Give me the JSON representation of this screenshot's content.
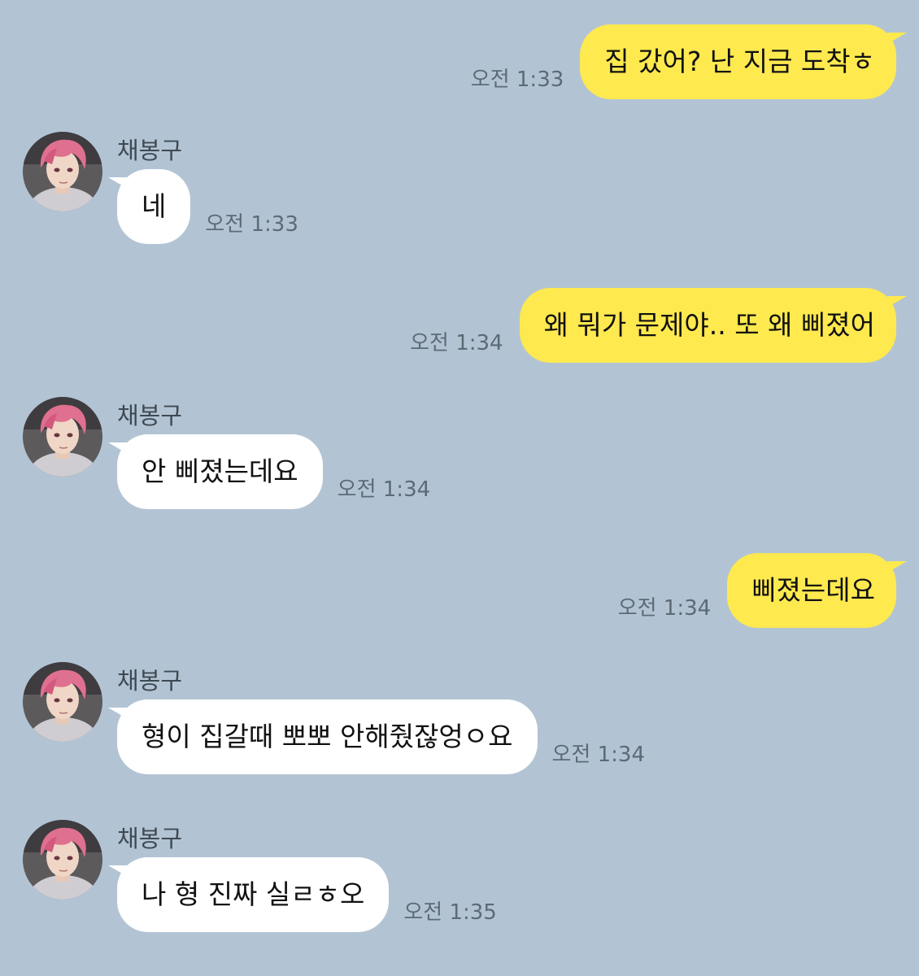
{
  "contact": {
    "name": "채봉구"
  },
  "messages": [
    {
      "side": "out",
      "text": "집 갔어? 난 지금 도착ㅎ",
      "time": "오전 1:33"
    },
    {
      "side": "in",
      "sender": "채봉구",
      "text": "네",
      "time": "오전 1:33"
    },
    {
      "side": "out",
      "text": "왜 뭐가 문제야.. 또 왜 삐졌어",
      "time": "오전 1:34"
    },
    {
      "side": "in",
      "sender": "채봉구",
      "text": "안 삐졌는데요",
      "time": "오전 1:34"
    },
    {
      "side": "out",
      "text": "삐졌는데요",
      "time": "오전 1:34"
    },
    {
      "side": "in",
      "sender": "채봉구",
      "text": "형이 집갈때 뽀뽀 안해줬잖엉ㅇ요",
      "time": "오전 1:34"
    },
    {
      "side": "in",
      "sender": "채봉구",
      "text": "나 형 진짜 실ㄹㅎ오",
      "time": "오전 1:35"
    }
  ],
  "colors": {
    "background": "#b2c4d4",
    "outgoing_bubble": "#fee94f",
    "incoming_bubble": "#ffffff",
    "timestamp": "#5d6a75"
  },
  "icons": {
    "avatar": "contact-avatar-icon"
  }
}
